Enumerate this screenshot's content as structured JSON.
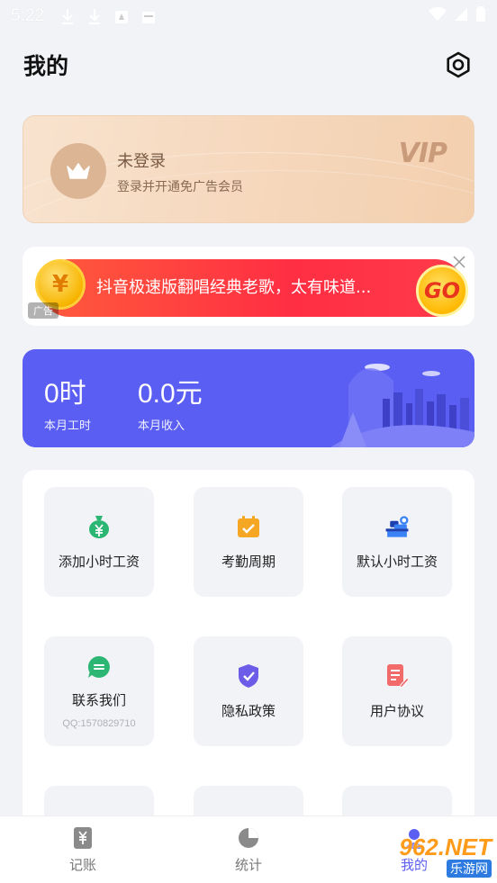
{
  "status_bar": {
    "time": "5:22"
  },
  "header": {
    "title": "我的"
  },
  "vip": {
    "title": "未登录",
    "subtitle": "登录并开通免广告会员",
    "mark": "VIP"
  },
  "ad": {
    "text": "抖音极速版翻唱经典老歌，太有味道...",
    "coin_symbol": "¥",
    "go_label": "GO",
    "label": "广告"
  },
  "stats": {
    "hours_value": "0时",
    "hours_label": "本月工时",
    "income_value": "0.0元",
    "income_label": "本月收入"
  },
  "grid": [
    {
      "label": "添加小时工资",
      "icon": "money-bag-icon",
      "color": "#2bb673"
    },
    {
      "label": "考勤周期",
      "icon": "calendar-check-icon",
      "color": "#f5a623"
    },
    {
      "label": "默认小时工资",
      "icon": "desk-worker-icon",
      "color": "#3b82f6"
    },
    {
      "label": "联系我们",
      "sub": "QQ:1570829710",
      "icon": "chat-bubble-icon",
      "color": "#2bb673"
    },
    {
      "label": "隐私政策",
      "icon": "shield-check-icon",
      "color": "#6c5ce7"
    },
    {
      "label": "用户协议",
      "icon": "document-edit-icon",
      "color": "#f26b6b"
    }
  ],
  "bottom_nav": [
    {
      "label": "记账",
      "icon": "ledger-icon"
    },
    {
      "label": "统计",
      "icon": "pie-chart-icon"
    },
    {
      "label": "我的",
      "icon": "user-icon"
    }
  ],
  "watermark": {
    "top": "962.NET",
    "bottom": "乐游网"
  },
  "colors": {
    "accent": "#5b5ef2",
    "vip_text": "#7a5a43",
    "ad_red": "#ff2e43"
  }
}
